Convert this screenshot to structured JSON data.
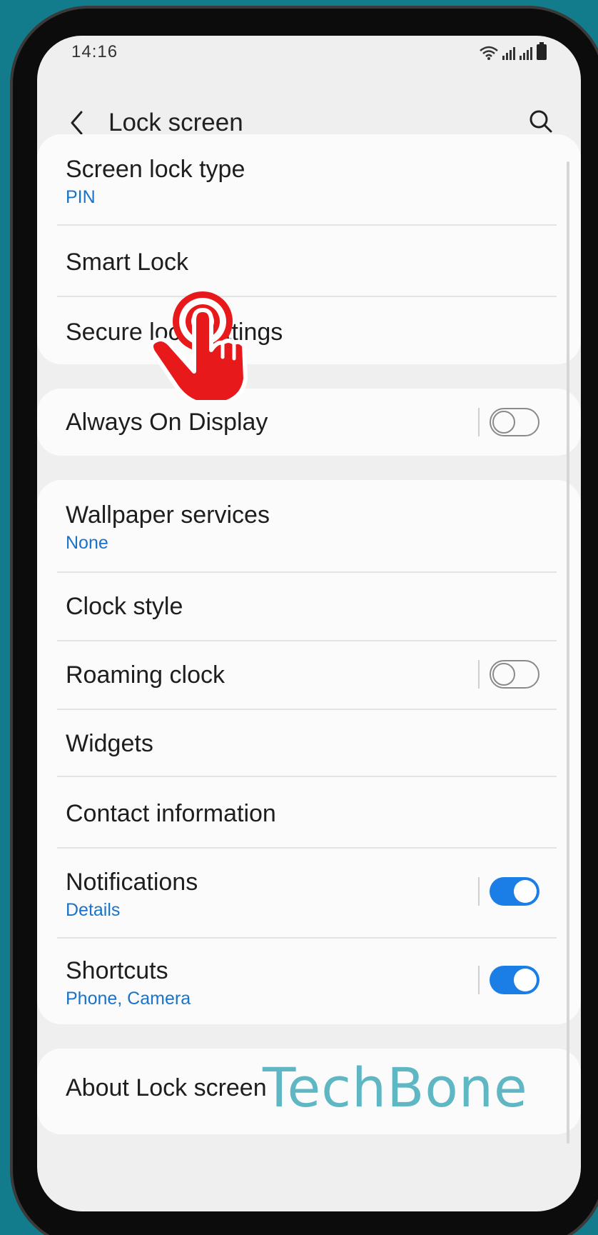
{
  "status_bar": {
    "time": "14:16"
  },
  "header": {
    "title": "Lock screen"
  },
  "groups": [
    {
      "items": [
        {
          "title": "Screen lock type",
          "subtitle": "PIN"
        },
        {
          "title": "Smart Lock"
        },
        {
          "title": "Secure lock settings"
        }
      ]
    },
    {
      "items": [
        {
          "title": "Always On Display",
          "toggle": "off"
        }
      ]
    },
    {
      "items": [
        {
          "title": "Wallpaper services",
          "subtitle": "None"
        },
        {
          "title": "Clock style"
        },
        {
          "title": "Roaming clock",
          "toggle": "off"
        },
        {
          "title": "Widgets"
        },
        {
          "title": "Contact information"
        },
        {
          "title": "Notifications",
          "subtitle": "Details",
          "toggle": "on"
        },
        {
          "title": "Shortcuts",
          "subtitle": "Phone, Camera",
          "toggle": "on"
        }
      ]
    },
    {
      "items": [
        {
          "title": "About Lock screen"
        }
      ]
    }
  ],
  "overlay": {
    "tap_indicator": "hand-tap-icon"
  },
  "watermark": "TechBone",
  "colors": {
    "accent": "#1a7ee6",
    "subtitle": "#1a73c8",
    "background": "#127c8c",
    "hand": "#e8191b"
  }
}
